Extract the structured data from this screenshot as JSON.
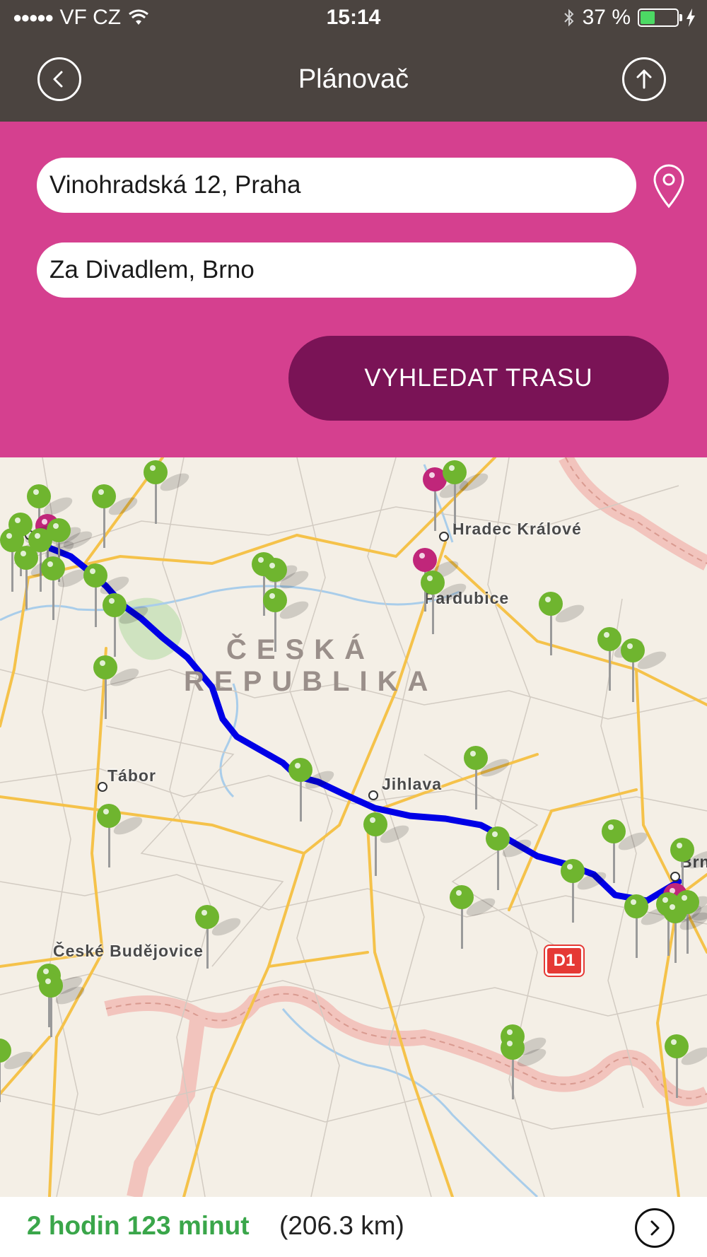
{
  "status_bar": {
    "carrier": "VF CZ",
    "signal_dots": "●●●●●",
    "time": "15:14",
    "battery_text": "37 %",
    "battery_level": 0.37
  },
  "nav": {
    "title": "Plánovač",
    "back_icon": "chevron-left-icon",
    "share_icon": "arrow-up-icon"
  },
  "planner": {
    "from_value": "Vinohradská 12, Praha",
    "to_value": "Za Divadlem, Brno",
    "location_icon": "location-pin-icon",
    "search_label": "VYHLEDAT TRASU"
  },
  "map": {
    "country_line1": "ČESKÁ",
    "country_line2": "REPUBLIKA",
    "cities": {
      "hradec": "Hradec Králové",
      "pardubice": "Pardubice",
      "tabor": "Tábor",
      "jihlava": "Jihlava",
      "budejovice": "České Budějovice",
      "brno": "Brno"
    },
    "highway": "D1",
    "colors": {
      "route": "#0000e6",
      "pin_green": "#6fb52f",
      "pin_magenta": "#c0267a",
      "accent": "#d5408f"
    }
  },
  "summary": {
    "duration": "2 hodin 123 minut",
    "distance": "(206.3 km)",
    "detail_icon": "chevron-right-icon"
  }
}
